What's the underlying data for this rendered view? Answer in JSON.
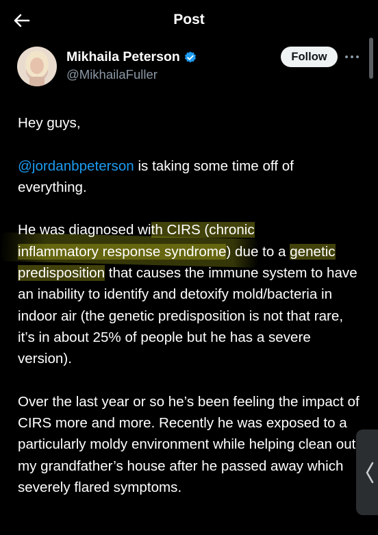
{
  "header": {
    "title": "Post"
  },
  "author": {
    "display_name": "Mikhaila Peterson",
    "handle": "@MikhailaFuller",
    "follow_label": "Follow"
  },
  "post": {
    "p1": "Hey guys,",
    "p2_mention": "@jordanbpeterson",
    "p2_rest": " is taking some time off of everything.",
    "p3_pre": "He was diagnosed wi",
    "p3_hl1": "th CIRS (chronic",
    "p3_hl2": "inflammatory response syndrome",
    "p3_mid": ") due to a ",
    "p3_hl3": "genetic predisposition",
    "p3_rest": " that causes the immune system to have an inability to identify and detoxify mold/bacteria in indoor air (the genetic predisposition is not that rare, it’s in about 25% of people but he has a severe version).",
    "p4": "Over the last year or so he’s been feeling the impact of CIRS more and more. Recently he was exposed to a particularly moldy environment while helping clean out my grandfather’s house after he passed away which severely flared symptoms."
  },
  "colors": {
    "background": "#000000",
    "text": "#e7e9ea",
    "link": "#1d9bf0",
    "verified": "#1d9bf0",
    "highlight": "#cdd022"
  },
  "icons": [
    "back-arrow-icon",
    "verified-badge-icon",
    "more-icon",
    "chevron-left-icon"
  ]
}
